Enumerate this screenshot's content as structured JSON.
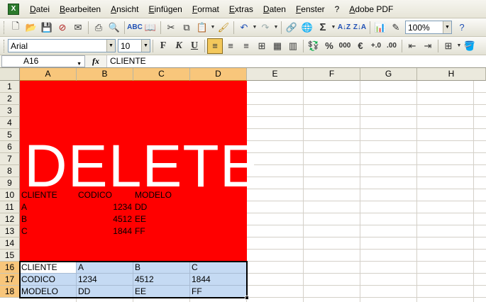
{
  "menu": {
    "items": [
      "Datei",
      "Bearbeiten",
      "Ansicht",
      "Einfügen",
      "Format",
      "Extras",
      "Daten",
      "Fenster",
      "?",
      "Adobe PDF"
    ]
  },
  "toolbar": {
    "zoom": "100%",
    "font_name": "Arial",
    "font_size": "10"
  },
  "formula_bar": {
    "name_box": "A16",
    "fx_label": "fx",
    "content": "CLIENTE"
  },
  "grid": {
    "columns": [
      "A",
      "B",
      "C",
      "D",
      "E",
      "F",
      "G",
      "H"
    ],
    "rows": [
      "1",
      "2",
      "3",
      "4",
      "5",
      "6",
      "7",
      "8",
      "9",
      "10",
      "11",
      "12",
      "13",
      "14",
      "15",
      "16",
      "17",
      "18"
    ],
    "overlay_text": "DELETE",
    "cells": {
      "A10": "CLIENTE",
      "B10": "CODICO",
      "C10": "MODELO",
      "A11": "A",
      "B11": "1234",
      "C11": "DD",
      "A12": "B",
      "B12": "4512",
      "C12": "EE",
      "A13": "C",
      "B13": "1844",
      "C13": "FF",
      "A16": "CLIENTE",
      "B16": "A",
      "C16": "B",
      "D16": "C",
      "A17": "CODICO",
      "B17": "1234",
      "C17": "4512",
      "D17": "1844",
      "A18": "MODELO",
      "B18": "DD",
      "C18": "EE",
      "D18": "FF"
    }
  },
  "colors": {
    "red_block": "#ff0000",
    "selection_fill": "#c5daf3",
    "header_selected": "#f8c67b"
  }
}
